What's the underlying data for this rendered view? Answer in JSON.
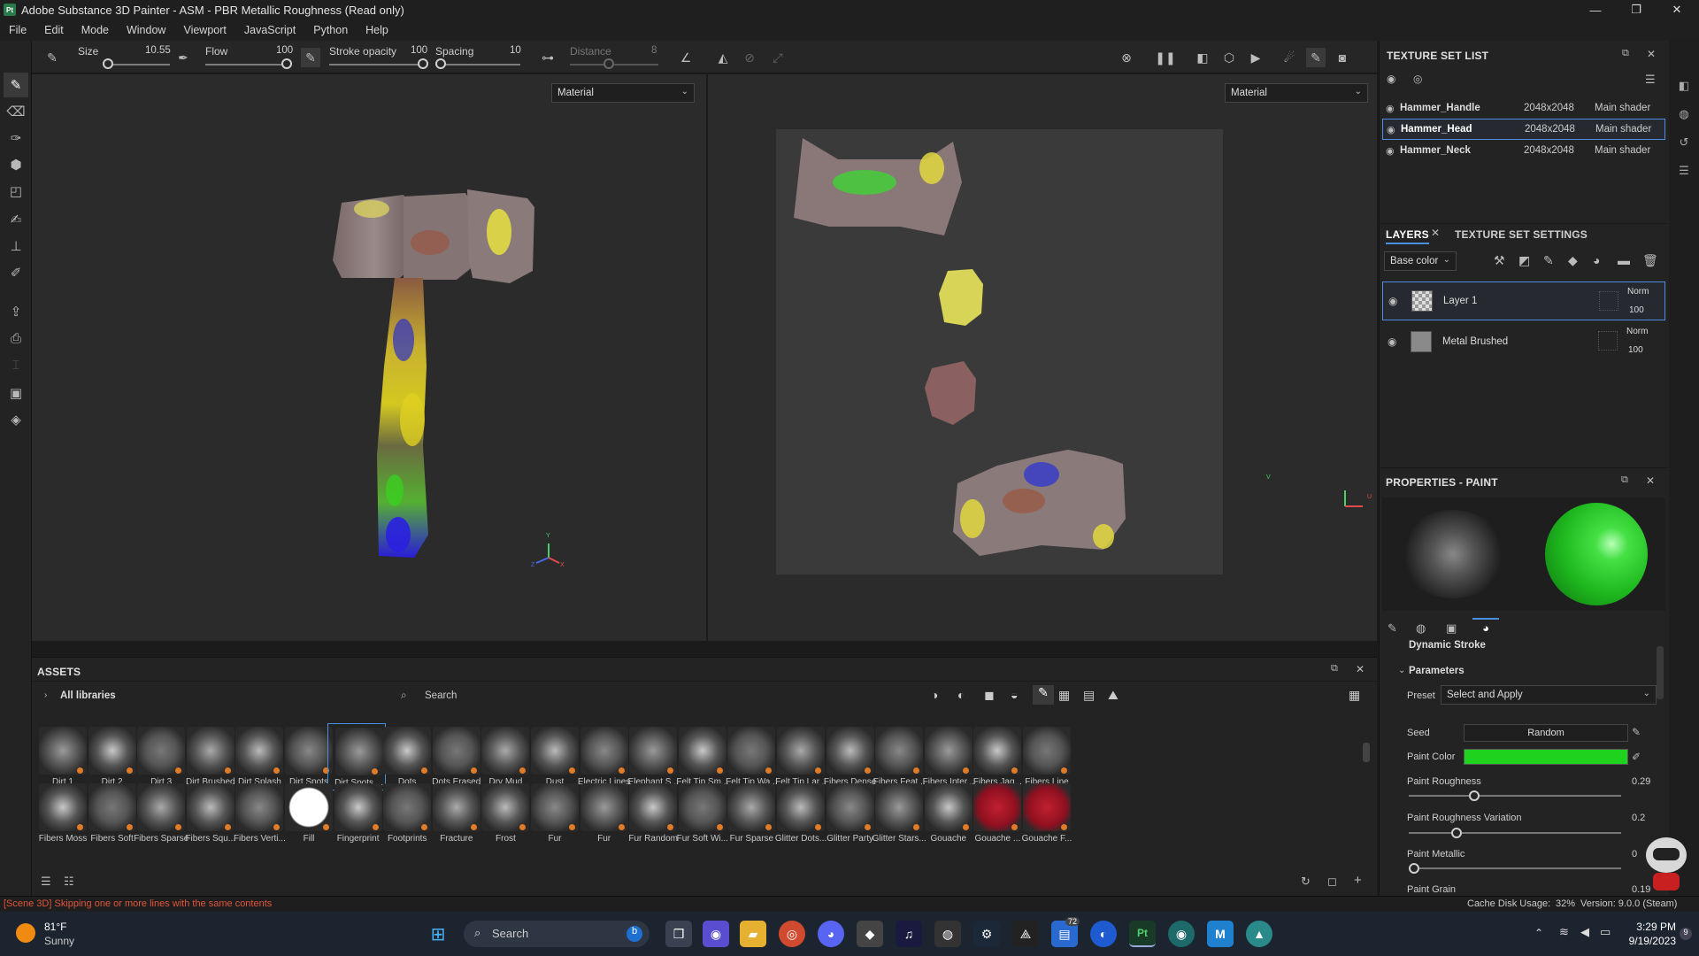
{
  "window": {
    "title": "Adobe Substance 3D Painter - ASM - PBR Metallic Roughness (Read only)",
    "app_badge": "Pt"
  },
  "menu": [
    "File",
    "Edit",
    "Mode",
    "Window",
    "Viewport",
    "JavaScript",
    "Python",
    "Help"
  ],
  "toolbar": {
    "size_label": "Size",
    "size_value": "10.55",
    "flow_label": "Flow",
    "flow_value": "100",
    "stroke_opacity_label": "Stroke opacity",
    "stroke_opacity_value": "100",
    "spacing_label": "Spacing",
    "spacing_value": "10",
    "distance_label": "Distance",
    "distance_value": "8"
  },
  "viewport": {
    "left_mode": "Material",
    "right_mode": "Material",
    "axis_y": "Y",
    "axis_x": "X",
    "axis_z": "Z",
    "uv_v": "V",
    "uv_u": "U"
  },
  "texture_set_list": {
    "title": "TEXTURE SET LIST",
    "rows": [
      {
        "name": "Hammer_Handle",
        "res": "2048x2048",
        "shader": "Main shader"
      },
      {
        "name": "Hammer_Head",
        "res": "2048x2048",
        "shader": "Main shader"
      },
      {
        "name": "Hammer_Neck",
        "res": "2048x2048",
        "shader": "Main shader"
      }
    ]
  },
  "layers": {
    "tab_layers": "LAYERS",
    "tab_settings": "TEXTURE SET SETTINGS",
    "channel": "Base color",
    "items": [
      {
        "name": "Layer 1",
        "blend": "Norm",
        "opacity": "100"
      },
      {
        "name": "Metal Brushed",
        "blend": "Norm",
        "opacity": "100"
      }
    ]
  },
  "properties": {
    "title": "PROPERTIES - PAINT",
    "section_dynamic": "Dynamic Stroke",
    "section_params": "Parameters",
    "preset_label": "Preset",
    "preset_value": "Select and Apply",
    "seed_label": "Seed",
    "seed_value": "Random",
    "paint_color_label": "Paint Color",
    "paint_color": "#1ed21e",
    "roughness_label": "Paint Roughness",
    "roughness_value": "0.29",
    "roughness_var_label": "Paint Roughness Variation",
    "roughness_var_value": "0.2",
    "metallic_label": "Paint Metallic",
    "metallic_value": "0",
    "grain_label": "Paint Grain",
    "grain_value": "0.19"
  },
  "assets": {
    "title": "ASSETS",
    "all_libraries": "All libraries",
    "search_placeholder": "Search",
    "row1": [
      "Dirt 1",
      "Dirt 2",
      "Dirt 3",
      "Dirt Brushed",
      "Dirt Splash",
      "Dirt Spots",
      "Dirt Spots ...",
      "Dots",
      "Dots Erased",
      "Dry Mud",
      "Dust",
      "Electric Lines",
      "Elephant S...",
      "Felt Tip Sm...",
      "Felt Tip Wa...",
      "Felt Tip Lar...",
      "Fibers Dense",
      "Fibers Feat...",
      "Fibers Inter...",
      "Fibers Jag...",
      "Fibers Line"
    ],
    "row2": [
      "Fibers Moss",
      "Fibers Soft",
      "Fibers Sparse",
      "Fibers Squ...",
      "Fibers Verti...",
      "Fill",
      "Fingerprint",
      "Footprints",
      "Fracture",
      "Frost",
      "Fur",
      "Fur",
      "Fur Random",
      "Fur Soft Wi...",
      "Fur Sparse",
      "Glitter Dots...",
      "Glitter Party",
      "Glitter Stars...",
      "Gouache",
      "Gouache ...",
      "Gouache F..."
    ]
  },
  "status": {
    "message": "[Scene 3D] Skipping one or more lines with the same contents",
    "cache": "Cache Disk Usage:",
    "cache_pct": "32%",
    "version": "Version: 9.0.0 (Steam)"
  },
  "taskbar": {
    "weather_temp": "81°F",
    "weather_desc": "Sunny",
    "search": "Search",
    "time": "3:29 PM",
    "date": "9/19/2023",
    "notif_count": "9",
    "badge_72": "72"
  },
  "colors": {
    "accent": "#4a8fe0",
    "paint": "#1ed21e",
    "status_msg": "#e0553c"
  }
}
